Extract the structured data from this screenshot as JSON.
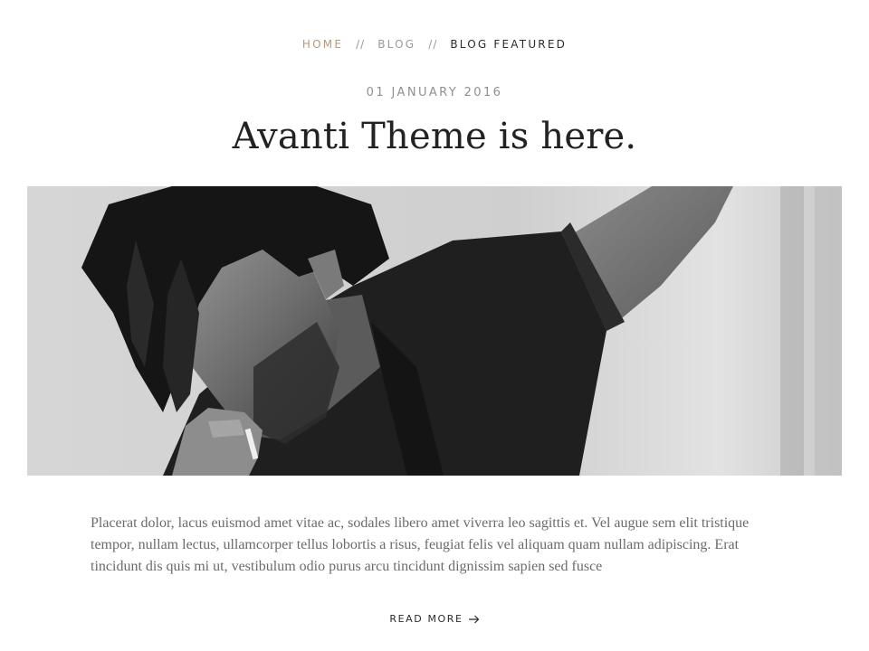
{
  "breadcrumb": {
    "home": "HOME",
    "blog": "BLOG",
    "current": "BLOG FEATURED",
    "separator": "//"
  },
  "post": {
    "date": "01 JANUARY 2016",
    "title": "Avanti Theme is here.",
    "hero_alt": "Black and white photo of a man with long hair smoking a cigarette",
    "excerpt": "Placerat dolor, lacus euismod amet vitae ac, sodales libero amet viverra leo sagittis et. Vel augue sem elit tristique tempor, nullam lectus, ullamcorper tellus lobortis a risus, feugiat felis vel aliquam quam nullam adipiscing. Erat tincidunt dis quis mi ut, vestibulum odio purus arcu tincidunt dignissim sapien sed fusce",
    "read_more": "READ MORE"
  },
  "colors": {
    "accent": "#b39a7d",
    "muted": "#9a9a9a",
    "text": "#222222",
    "body_text": "#6b6b6b"
  },
  "icons": {
    "read_more": "arrow-right-icon"
  }
}
